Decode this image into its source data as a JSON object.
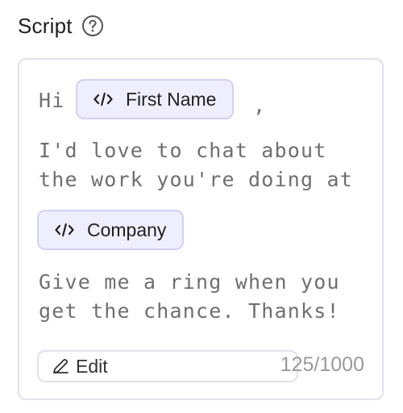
{
  "header": {
    "title": "Script",
    "help_icon": "question-circle-icon"
  },
  "script": {
    "greeting": "Hi",
    "first_name_chip": "First Name",
    "comma": ",",
    "line_2": "I'd love to chat about",
    "line_3": "the work you're doing at",
    "company_chip": "Company",
    "line_5": "Give me a ring when you",
    "line_6": "get the chance. Thanks!",
    "chip_icon": "code-icon"
  },
  "footer": {
    "edit_label": "Edit",
    "edit_icon": "pencil-icon",
    "char_count": "125/1000"
  },
  "colors": {
    "chip_background": "#efeefd",
    "chip_border": "#d4d0f3",
    "card_border": "#e2e0ec",
    "script_text": "#6f6f6f",
    "count_text": "#9a9a9a"
  }
}
